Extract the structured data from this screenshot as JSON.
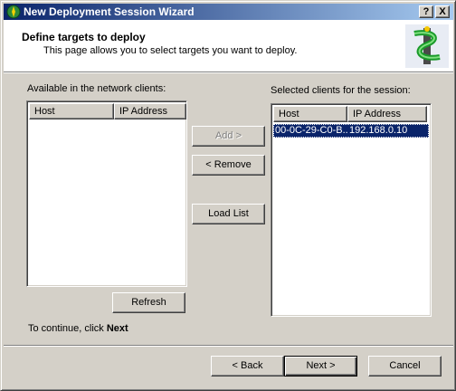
{
  "window": {
    "title": "New Deployment Session Wizard",
    "help_label": "?",
    "close_label": "X"
  },
  "header": {
    "title": "Define targets to deploy",
    "description": "This page allows you to select targets you want to deploy."
  },
  "available": {
    "label": "Available in the network clients:",
    "columns": [
      "Host",
      "IP Address"
    ],
    "rows": []
  },
  "selected": {
    "label": "Selected clients for the session:",
    "columns": [
      "Host",
      "IP Address"
    ],
    "rows": [
      {
        "host": "00-0C-29-C0-B...",
        "ip": "192.168.0.10"
      }
    ]
  },
  "buttons": {
    "add": "Add >",
    "remove": "< Remove",
    "load_list": "Load List",
    "refresh": "Refresh",
    "back": "< Back",
    "next": "Next >",
    "cancel": "Cancel"
  },
  "footer": {
    "continue_prefix": "To continue, click ",
    "continue_bold": "Next"
  },
  "colors": {
    "title_bar_start": "#0a246a",
    "title_bar_end": "#a6caf0",
    "selection": "#0a246a",
    "face": "#d4d0c8"
  }
}
